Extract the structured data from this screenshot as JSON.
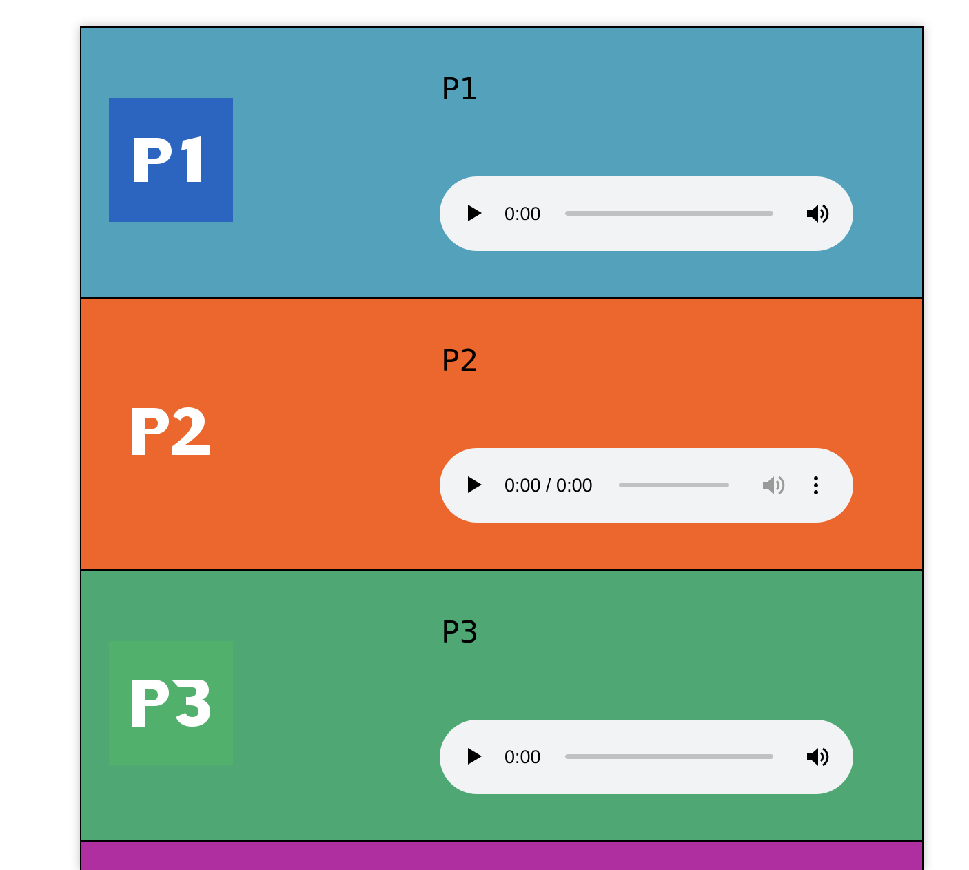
{
  "channels": [
    {
      "id": "p1",
      "name": "P1",
      "logo_text": "P1",
      "row_bg": "#54a1bc",
      "logo_bg": "#2b65c0",
      "player": {
        "time": "0:00",
        "variant": "compact",
        "volume_icon": "volume-icon",
        "play_icon": "play-icon"
      }
    },
    {
      "id": "p2",
      "name": "P2",
      "logo_text": "P2",
      "row_bg": "#eb672e",
      "logo_bg": "#eb672e",
      "player": {
        "time": "0:00 / 0:00",
        "variant": "full",
        "volume_icon": "volume-muted-icon",
        "play_icon": "play-icon",
        "more_icon": "more-options-icon"
      }
    },
    {
      "id": "p3",
      "name": "P3",
      "logo_text": "P3",
      "row_bg": "#4fa874",
      "logo_bg": "#52b06d",
      "player": {
        "time": "0:00",
        "variant": "compact",
        "volume_icon": "volume-icon",
        "play_icon": "play-icon"
      }
    },
    {
      "id": "p4",
      "row_bg": "#b02fa0"
    }
  ]
}
